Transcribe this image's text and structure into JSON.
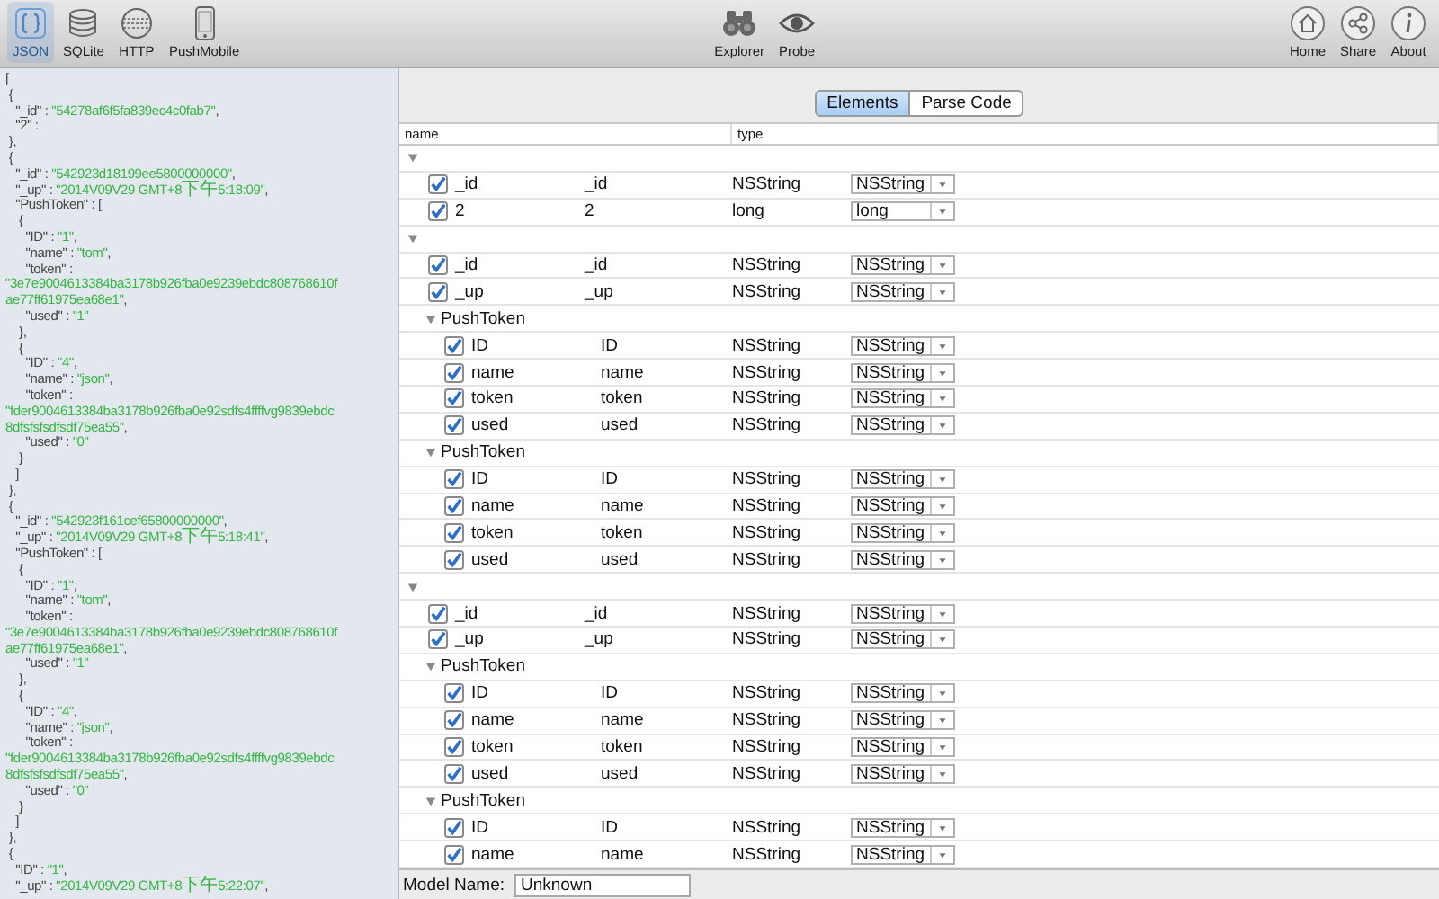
{
  "toolbar": {
    "left": [
      {
        "label": "JSON",
        "selected": true
      },
      {
        "label": "SQLite",
        "selected": false
      },
      {
        "label": "HTTP",
        "selected": false
      },
      {
        "label": "PushMobile",
        "selected": false
      }
    ],
    "center": [
      {
        "label": "Explorer",
        "selected": false
      },
      {
        "label": "Probe",
        "selected": false
      }
    ],
    "right": [
      {
        "label": "Home",
        "selected": false
      },
      {
        "label": "Share",
        "selected": false
      },
      {
        "label": "About",
        "selected": false
      }
    ]
  },
  "json_view": {
    "lines": [
      {
        "text": "["
      },
      {
        "text": " {"
      },
      {
        "text": "   \"_id\" : ",
        "value": "\"54278af6f5fa839ec4c0fab7\"",
        "end": ","
      },
      {
        "text": "   \"2\" :"
      },
      {
        "text": " },"
      },
      {
        "text": " {"
      },
      {
        "text": "   \"_id\" : ",
        "value": "\"542923d18199ee5800000000\"",
        "end": ","
      },
      {
        "text": "   \"_up\" : ",
        "value": "\"2014V09V29 GMT+8下午5:18:09\"",
        "end": ","
      },
      {
        "text": "   \"PushToken\" : ["
      },
      {
        "text": "    {"
      },
      {
        "text": "      \"ID\" : ",
        "value": "\"1\"",
        "end": ","
      },
      {
        "text": "      \"name\" : ",
        "value": "\"tom\"",
        "end": ","
      },
      {
        "text": "      \"token\" :"
      },
      {
        "value": "\"3e7e9004613384ba3178b926fba0e9239ebdc808768610f"
      },
      {
        "value": "ae77ff61975ea68e1\"",
        "end": ","
      },
      {
        "text": "      \"used\" : ",
        "value": "\"1\""
      },
      {
        "text": "    },"
      },
      {
        "text": "    {"
      },
      {
        "text": "      \"ID\" : ",
        "value": "\"4\"",
        "end": ","
      },
      {
        "text": "      \"name\" : ",
        "value": "\"json\"",
        "end": ","
      },
      {
        "text": "      \"token\" :"
      },
      {
        "value": "\"fder9004613384ba3178b926fba0e92sdfs4ffffvg9839ebdc"
      },
      {
        "value": "8dfsfsfsdfsdf75ea55\"",
        "end": ","
      },
      {
        "text": "      \"used\" : ",
        "value": "\"0\""
      },
      {
        "text": "    }"
      },
      {
        "text": "   ]"
      },
      {
        "text": " },"
      },
      {
        "text": " {"
      },
      {
        "text": "   \"_id\" : ",
        "value": "\"542923f161cef65800000000\"",
        "end": ","
      },
      {
        "text": "   \"_up\" : ",
        "value": "\"2014V09V29 GMT+8下午5:18:41\"",
        "end": ","
      },
      {
        "text": "   \"PushToken\" : ["
      },
      {
        "text": "    {"
      },
      {
        "text": "      \"ID\" : ",
        "value": "\"1\"",
        "end": ","
      },
      {
        "text": "      \"name\" : ",
        "value": "\"tom\"",
        "end": ","
      },
      {
        "text": "      \"token\" :"
      },
      {
        "value": "\"3e7e9004613384ba3178b926fba0e9239ebdc808768610f"
      },
      {
        "value": "ae77ff61975ea68e1\"",
        "end": ","
      },
      {
        "text": "      \"used\" : ",
        "value": "\"1\""
      },
      {
        "text": "    },"
      },
      {
        "text": "    {"
      },
      {
        "text": "      \"ID\" : ",
        "value": "\"4\"",
        "end": ","
      },
      {
        "text": "      \"name\" : ",
        "value": "\"json\"",
        "end": ","
      },
      {
        "text": "      \"token\" :"
      },
      {
        "value": "\"fder9004613384ba3178b926fba0e92sdfs4ffffvg9839ebdc"
      },
      {
        "value": "8dfsfsfsdfsdf75ea55\"",
        "end": ","
      },
      {
        "text": "      \"used\" : ",
        "value": "\"0\""
      },
      {
        "text": "    }"
      },
      {
        "text": "   ]"
      },
      {
        "text": " },"
      },
      {
        "text": " {"
      },
      {
        "text": "   \"ID\" : ",
        "value": "\"1\"",
        "end": ","
      },
      {
        "text": "   \"_up\" : ",
        "value": "\"2014V09V29 GMT+8下午5:22:07\"",
        "end": ","
      }
    ]
  },
  "segments": [
    {
      "label": "Elements",
      "selected": true
    },
    {
      "label": "Parse Code",
      "selected": false
    }
  ],
  "tree": {
    "columns": [
      "name",
      "type"
    ],
    "rows": [
      {
        "kind": "object",
        "expanded": true,
        "children": [
          {
            "kind": "field",
            "checked": true,
            "name": "_id",
            "property": "_id",
            "type": "NSString",
            "type_choice": "NSString"
          },
          {
            "kind": "field",
            "checked": true,
            "name": "2",
            "property": "2",
            "type": "long",
            "type_choice": "long"
          }
        ]
      },
      {
        "kind": "object",
        "expanded": true,
        "children": [
          {
            "kind": "field",
            "checked": true,
            "name": "_id",
            "property": "_id",
            "type": "NSString",
            "type_choice": "NSString"
          },
          {
            "kind": "field",
            "checked": true,
            "name": "_up",
            "property": "_up",
            "type": "NSString",
            "type_choice": "NSString"
          },
          {
            "kind": "array",
            "label": "PushToken",
            "expanded": true,
            "children": [
              {
                "kind": "field",
                "checked": true,
                "name": "ID",
                "property": "ID",
                "type": "NSString",
                "type_choice": "NSString"
              },
              {
                "kind": "field",
                "checked": true,
                "name": "name",
                "property": "name",
                "type": "NSString",
                "type_choice": "NSString"
              },
              {
                "kind": "field",
                "checked": true,
                "name": "token",
                "property": "token",
                "type": "NSString",
                "type_choice": "NSString"
              },
              {
                "kind": "field",
                "checked": true,
                "name": "used",
                "property": "used",
                "type": "NSString",
                "type_choice": "NSString"
              }
            ]
          },
          {
            "kind": "array",
            "label": "PushToken",
            "expanded": true,
            "children": [
              {
                "kind": "field",
                "checked": true,
                "name": "ID",
                "property": "ID",
                "type": "NSString",
                "type_choice": "NSString"
              },
              {
                "kind": "field",
                "checked": true,
                "name": "name",
                "property": "name",
                "type": "NSString",
                "type_choice": "NSString"
              },
              {
                "kind": "field",
                "checked": true,
                "name": "token",
                "property": "token",
                "type": "NSString",
                "type_choice": "NSString"
              },
              {
                "kind": "field",
                "checked": true,
                "name": "used",
                "property": "used",
                "type": "NSString",
                "type_choice": "NSString"
              }
            ]
          }
        ]
      },
      {
        "kind": "object",
        "expanded": true,
        "children": [
          {
            "kind": "field",
            "checked": true,
            "name": "_id",
            "property": "_id",
            "type": "NSString",
            "type_choice": "NSString"
          },
          {
            "kind": "field",
            "checked": true,
            "name": "_up",
            "property": "_up",
            "type": "NSString",
            "type_choice": "NSString"
          },
          {
            "kind": "array",
            "label": "PushToken",
            "expanded": true,
            "children": [
              {
                "kind": "field",
                "checked": true,
                "name": "ID",
                "property": "ID",
                "type": "NSString",
                "type_choice": "NSString"
              },
              {
                "kind": "field",
                "checked": true,
                "name": "name",
                "property": "name",
                "type": "NSString",
                "type_choice": "NSString"
              },
              {
                "kind": "field",
                "checked": true,
                "name": "token",
                "property": "token",
                "type": "NSString",
                "type_choice": "NSString"
              },
              {
                "kind": "field",
                "checked": true,
                "name": "used",
                "property": "used",
                "type": "NSString",
                "type_choice": "NSString"
              }
            ]
          },
          {
            "kind": "array",
            "label": "PushToken",
            "expanded": true,
            "children": [
              {
                "kind": "field",
                "checked": true,
                "name": "ID",
                "property": "ID",
                "type": "NSString",
                "type_choice": "NSString"
              },
              {
                "kind": "field",
                "checked": true,
                "name": "name",
                "property": "name",
                "type": "NSString",
                "type_choice": "NSString"
              }
            ]
          }
        ]
      }
    ]
  },
  "model_bar": {
    "label": "Model Name:",
    "value": "Unknown"
  }
}
